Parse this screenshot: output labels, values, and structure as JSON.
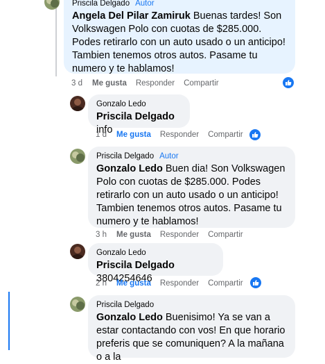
{
  "comments": [
    {
      "author": "Priscila Delgado",
      "badge": "Autor",
      "mention": "Angela Del Pilar Zamiruk",
      "text": " Buenas tardes! Son Volkswagen Polo con cuotas de $285.000. Podes retirarlo con un auto usado o un anticipo! Tambien tenemos otros autos. Pasame tu numero y te hablamos!",
      "time": "3 d",
      "like": "Me gusta",
      "reply": "Responder",
      "share": "Compartir"
    },
    {
      "author": "Gonzalo Ledo",
      "mention": "Priscila Delgado",
      "text": " info",
      "time": "1 d",
      "like": "Me gusta",
      "reply": "Responder",
      "share": "Compartir"
    },
    {
      "author": "Priscila Delgado",
      "badge": "Autor",
      "mention": "Gonzalo Ledo",
      "text": " Buen dia! Son Volkswagen Polo con cuotas de $285.000. Podes retirarlo con un auto usado o un anticipo! Tambien tenemos otros autos. Pasame tu numero y te hablamos!",
      "time": "3 h",
      "like": "Me gusta",
      "reply": "Responder",
      "share": "Compartir"
    },
    {
      "author": "Gonzalo Ledo",
      "mention": "Priscila Delgado",
      "text": " 3804254646",
      "time": "2 h",
      "like": "Me gusta",
      "reply": "Responder",
      "share": "Compartir"
    },
    {
      "author": "Priscila Delgado",
      "mention": "Gonzalo Ledo",
      "text": " Buenisimo! Ya se van a estar contactando con vos! En que horario preferis que se comuniquen? A la mañana o a la"
    }
  ],
  "colors": {
    "accent": "#1877f2",
    "bubble": "#f0f2f5",
    "highlight_bubble": "#e7f3ff",
    "meta_text": "#65676b"
  },
  "icons": {
    "reaction": "thumbs-up-icon"
  }
}
